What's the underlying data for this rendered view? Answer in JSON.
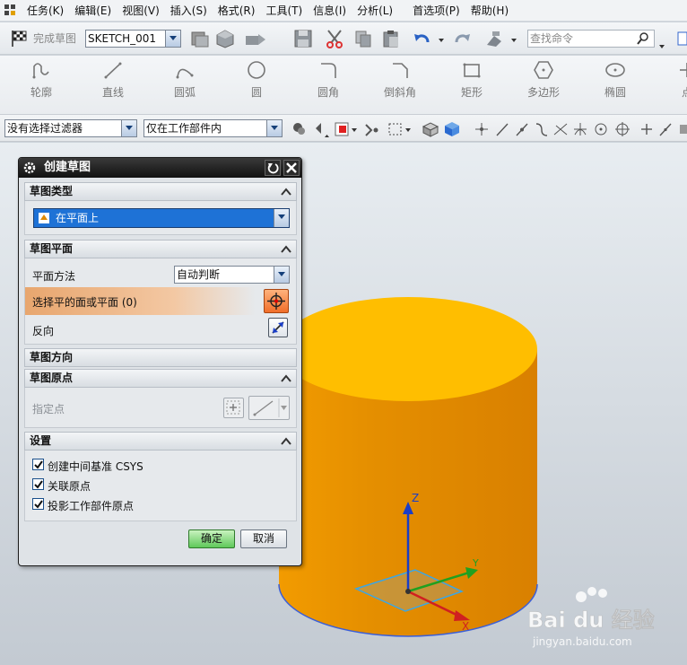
{
  "menubar": {
    "items": [
      "任务(K)",
      "编辑(E)",
      "视图(V)",
      "插入(S)",
      "格式(R)",
      "工具(T)",
      "信息(I)",
      "分析(L)",
      "首选项(P)",
      "帮助(H)"
    ]
  },
  "toolbar": {
    "finish_sketch": "完成草图",
    "sketch_name": "SKETCH_001",
    "search_placeholder": "查找命令"
  },
  "curve_tools": [
    "轮廓",
    "直线",
    "圆弧",
    "圆",
    "圆角",
    "倒斜角",
    "矩形",
    "多边形",
    "椭圆",
    "点"
  ],
  "filter_bar": {
    "selection_filter": "没有选择过滤器",
    "scope": "仅在工作部件内"
  },
  "dialog": {
    "title": "创建草图",
    "sketch_type": {
      "header": "草图类型",
      "value": "在平面上"
    },
    "sketch_plane": {
      "header": "草图平面",
      "plane_method_label": "平面方法",
      "plane_method_value": "自动判断",
      "select_face_label": "选择平的面或平面 (0)",
      "reverse_label": "反向"
    },
    "sketch_orientation": {
      "header": "草图方向"
    },
    "sketch_origin": {
      "header": "草图原点",
      "specify_point_label": "指定点"
    },
    "settings": {
      "header": "设置",
      "options": [
        {
          "label": "创建中间基准 CSYS",
          "checked": true
        },
        {
          "label": "关联原点",
          "checked": true
        },
        {
          "label": "投影工作部件原点",
          "checked": true
        }
      ]
    },
    "ok_label": "确定",
    "cancel_label": "取消"
  },
  "viewport": {
    "axis_x": "X",
    "axis_y": "Y",
    "axis_z": "Z",
    "cylinder_color": "#e08a00",
    "top_color": "#ffbe00"
  },
  "watermark": {
    "brand": "Bai du 经验",
    "url": "jingyan.baidu.com"
  }
}
